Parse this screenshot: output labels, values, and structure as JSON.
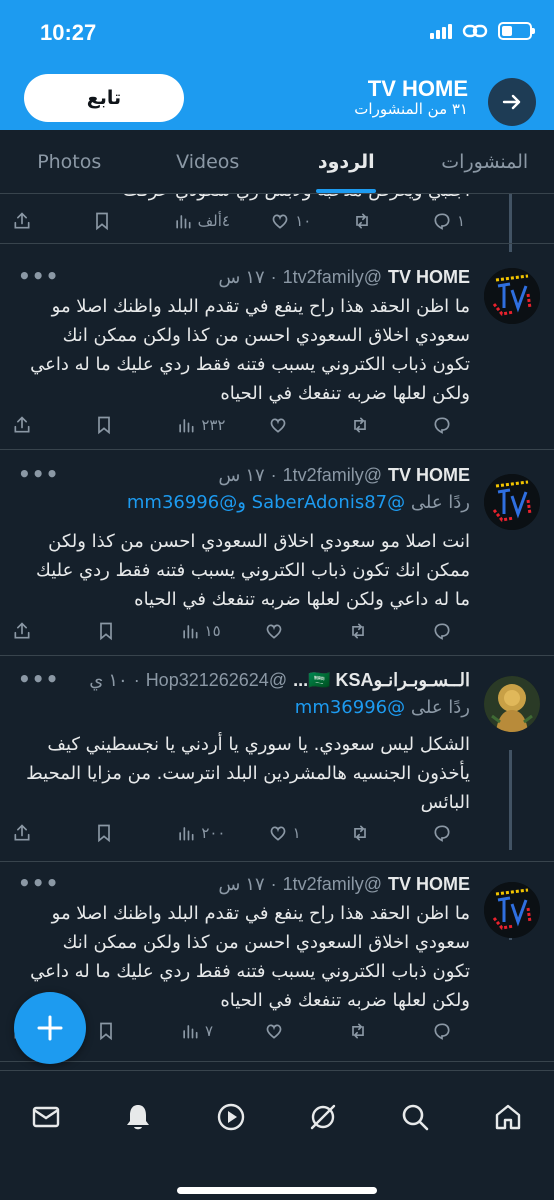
{
  "status_bar": {
    "time": "10:27"
  },
  "header": {
    "profile_name": "TV HOME",
    "post_count": "٣١ من المنشورات",
    "follow_label": "تابع"
  },
  "tabs": [
    {
      "label": "المنشورات"
    },
    {
      "label": "الردود"
    },
    {
      "label": "Videos"
    },
    {
      "label": "Photos"
    }
  ],
  "partial_tweet": {
    "body_cut": "اجنبي ويعرض مدحبه ولابس زي سعودي عرفت",
    "replies": "١",
    "retweets": "",
    "likes": "١٠",
    "views": "٤ألف"
  },
  "tweets": [
    {
      "name": "TV HOME",
      "handle": "@1tv2family",
      "time": "١٧ س",
      "reply_to": null,
      "body": "ما اظن الحقد هذا راح ينفع في تقدم البلد واظنك اصلا مو سعودي اخلاق السعودي احسن من كذا ولكن ممكن انك تكون ذباب الكتروني يسبب فتنه فقط ردي عليك ما له داعي ولكن لعلها ضربه تنفعك في الحياه",
      "replies": "",
      "retweets": "",
      "likes": "",
      "views": "٢٣٢"
    },
    {
      "name": "TV HOME",
      "handle": "@1tv2family",
      "time": "١٧ س",
      "reply_to_label": "ردًا على",
      "reply_to_mentions": "@SaberAdonis87 و@mm36996",
      "body": "انت اصلا مو سعودي اخلاق السعودي احسن من كذا ولكن ممكن انك تكون ذباب الكتروني يسبب فتنه فقط ردي عليك ما له داعي ولكن لعلها ضربه تنفعك في الحياه",
      "replies": "",
      "retweets": "",
      "likes": "",
      "views": "١٥"
    },
    {
      "name": "الــسـوبـرانـو🇸🇦 KSA...",
      "handle": "@Hop321262624",
      "time": "١٠ ي",
      "reply_to_label": "ردًا على",
      "reply_to_mentions": "@mm36996",
      "body": "الشكل ليس سعودي.  يا سوري يا أردني يا نجسطيني كيف يأخذون الجنسيه هالمشردين البلد انترست. من مزايا المحيط البائس",
      "replies": "",
      "retweets": "",
      "likes": "١",
      "views": "٢٠٠"
    },
    {
      "name": "TV HOME",
      "handle": "@1tv2family",
      "time": "١٧ س",
      "reply_to": null,
      "body": "ما اظن الحقد هذا راح ينفع في تقدم البلد واظنك اصلا مو سعودي اخلاق السعودي احسن من كذا ولكن ممكن انك تكون ذباب الكتروني يسبب فتنه فقط ردي عليك ما له داعي ولكن لعلها ضربه تنفعك في الحياه",
      "replies": "",
      "retweets": "",
      "likes": "",
      "views": "٧"
    }
  ],
  "icons": {
    "back": "arrow-right-icon",
    "compose": "plus-icon",
    "nav": [
      "mail-icon",
      "bell-icon",
      "play-icon",
      "communities-icon",
      "search-icon",
      "home-icon"
    ]
  },
  "colors": {
    "accent": "#1d9bf0",
    "background": "#15202b",
    "muted": "#8b98a5",
    "text": "#e7e9ea"
  }
}
